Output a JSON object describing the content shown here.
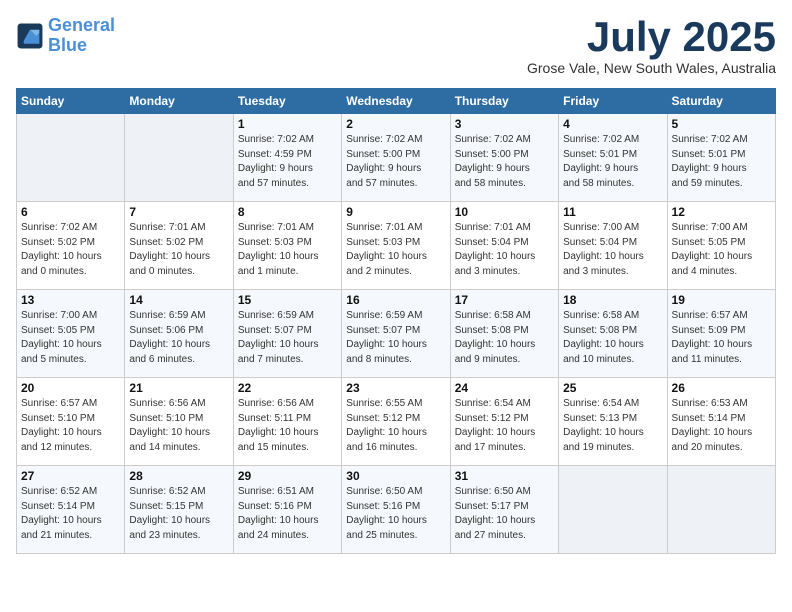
{
  "header": {
    "logo_line1": "General",
    "logo_line2": "Blue",
    "month_title": "July 2025",
    "subtitle": "Grose Vale, New South Wales, Australia"
  },
  "days_of_week": [
    "Sunday",
    "Monday",
    "Tuesday",
    "Wednesday",
    "Thursday",
    "Friday",
    "Saturday"
  ],
  "weeks": [
    [
      {
        "day": "",
        "info": ""
      },
      {
        "day": "",
        "info": ""
      },
      {
        "day": "1",
        "info": "Sunrise: 7:02 AM\nSunset: 4:59 PM\nDaylight: 9 hours\nand 57 minutes."
      },
      {
        "day": "2",
        "info": "Sunrise: 7:02 AM\nSunset: 5:00 PM\nDaylight: 9 hours\nand 57 minutes."
      },
      {
        "day": "3",
        "info": "Sunrise: 7:02 AM\nSunset: 5:00 PM\nDaylight: 9 hours\nand 58 minutes."
      },
      {
        "day": "4",
        "info": "Sunrise: 7:02 AM\nSunset: 5:01 PM\nDaylight: 9 hours\nand 58 minutes."
      },
      {
        "day": "5",
        "info": "Sunrise: 7:02 AM\nSunset: 5:01 PM\nDaylight: 9 hours\nand 59 minutes."
      }
    ],
    [
      {
        "day": "6",
        "info": "Sunrise: 7:02 AM\nSunset: 5:02 PM\nDaylight: 10 hours\nand 0 minutes."
      },
      {
        "day": "7",
        "info": "Sunrise: 7:01 AM\nSunset: 5:02 PM\nDaylight: 10 hours\nand 0 minutes."
      },
      {
        "day": "8",
        "info": "Sunrise: 7:01 AM\nSunset: 5:03 PM\nDaylight: 10 hours\nand 1 minute."
      },
      {
        "day": "9",
        "info": "Sunrise: 7:01 AM\nSunset: 5:03 PM\nDaylight: 10 hours\nand 2 minutes."
      },
      {
        "day": "10",
        "info": "Sunrise: 7:01 AM\nSunset: 5:04 PM\nDaylight: 10 hours\nand 3 minutes."
      },
      {
        "day": "11",
        "info": "Sunrise: 7:00 AM\nSunset: 5:04 PM\nDaylight: 10 hours\nand 3 minutes."
      },
      {
        "day": "12",
        "info": "Sunrise: 7:00 AM\nSunset: 5:05 PM\nDaylight: 10 hours\nand 4 minutes."
      }
    ],
    [
      {
        "day": "13",
        "info": "Sunrise: 7:00 AM\nSunset: 5:05 PM\nDaylight: 10 hours\nand 5 minutes."
      },
      {
        "day": "14",
        "info": "Sunrise: 6:59 AM\nSunset: 5:06 PM\nDaylight: 10 hours\nand 6 minutes."
      },
      {
        "day": "15",
        "info": "Sunrise: 6:59 AM\nSunset: 5:07 PM\nDaylight: 10 hours\nand 7 minutes."
      },
      {
        "day": "16",
        "info": "Sunrise: 6:59 AM\nSunset: 5:07 PM\nDaylight: 10 hours\nand 8 minutes."
      },
      {
        "day": "17",
        "info": "Sunrise: 6:58 AM\nSunset: 5:08 PM\nDaylight: 10 hours\nand 9 minutes."
      },
      {
        "day": "18",
        "info": "Sunrise: 6:58 AM\nSunset: 5:08 PM\nDaylight: 10 hours\nand 10 minutes."
      },
      {
        "day": "19",
        "info": "Sunrise: 6:57 AM\nSunset: 5:09 PM\nDaylight: 10 hours\nand 11 minutes."
      }
    ],
    [
      {
        "day": "20",
        "info": "Sunrise: 6:57 AM\nSunset: 5:10 PM\nDaylight: 10 hours\nand 12 minutes."
      },
      {
        "day": "21",
        "info": "Sunrise: 6:56 AM\nSunset: 5:10 PM\nDaylight: 10 hours\nand 14 minutes."
      },
      {
        "day": "22",
        "info": "Sunrise: 6:56 AM\nSunset: 5:11 PM\nDaylight: 10 hours\nand 15 minutes."
      },
      {
        "day": "23",
        "info": "Sunrise: 6:55 AM\nSunset: 5:12 PM\nDaylight: 10 hours\nand 16 minutes."
      },
      {
        "day": "24",
        "info": "Sunrise: 6:54 AM\nSunset: 5:12 PM\nDaylight: 10 hours\nand 17 minutes."
      },
      {
        "day": "25",
        "info": "Sunrise: 6:54 AM\nSunset: 5:13 PM\nDaylight: 10 hours\nand 19 minutes."
      },
      {
        "day": "26",
        "info": "Sunrise: 6:53 AM\nSunset: 5:14 PM\nDaylight: 10 hours\nand 20 minutes."
      }
    ],
    [
      {
        "day": "27",
        "info": "Sunrise: 6:52 AM\nSunset: 5:14 PM\nDaylight: 10 hours\nand 21 minutes."
      },
      {
        "day": "28",
        "info": "Sunrise: 6:52 AM\nSunset: 5:15 PM\nDaylight: 10 hours\nand 23 minutes."
      },
      {
        "day": "29",
        "info": "Sunrise: 6:51 AM\nSunset: 5:16 PM\nDaylight: 10 hours\nand 24 minutes."
      },
      {
        "day": "30",
        "info": "Sunrise: 6:50 AM\nSunset: 5:16 PM\nDaylight: 10 hours\nand 25 minutes."
      },
      {
        "day": "31",
        "info": "Sunrise: 6:50 AM\nSunset: 5:17 PM\nDaylight: 10 hours\nand 27 minutes."
      },
      {
        "day": "",
        "info": ""
      },
      {
        "day": "",
        "info": ""
      }
    ]
  ]
}
